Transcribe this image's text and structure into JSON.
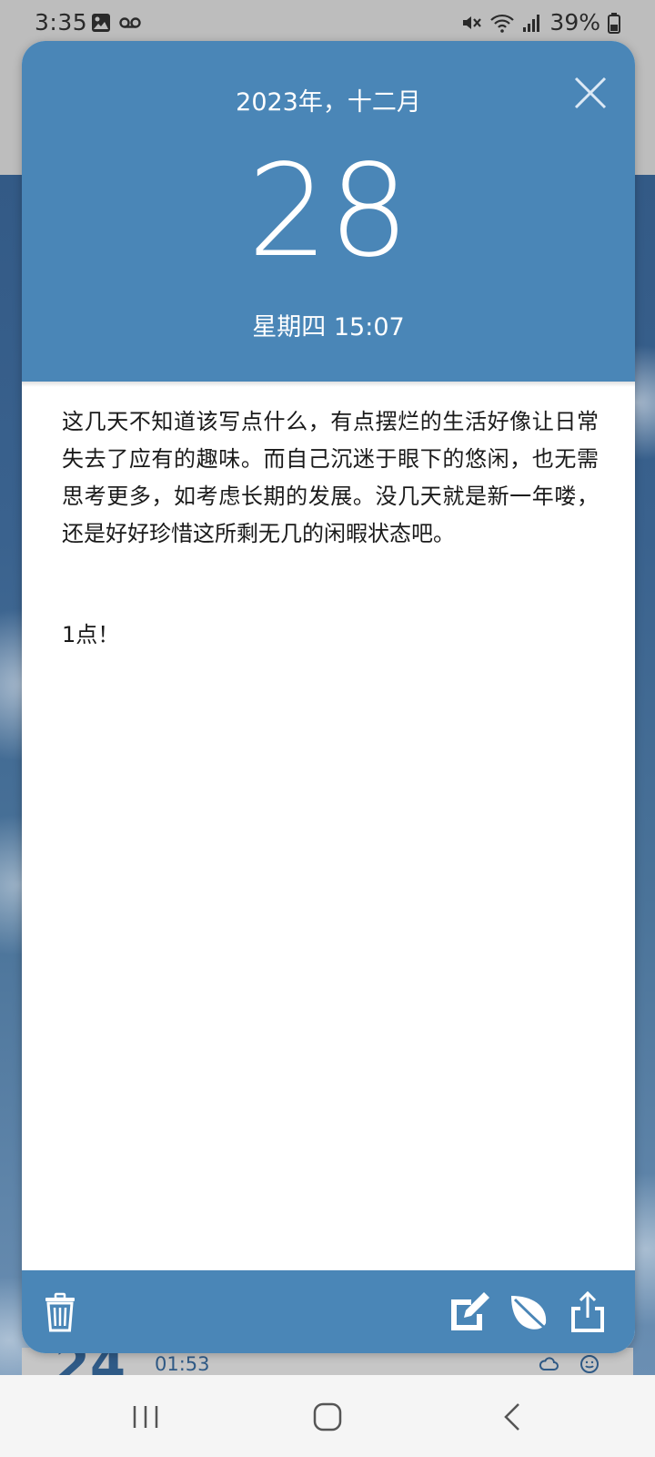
{
  "status_bar": {
    "time": "3:35",
    "battery": "39%",
    "left_icons": [
      "gallery-icon",
      "voicemail-icon"
    ],
    "right_icons": [
      "mute-icon",
      "wifi-icon",
      "signal-icon",
      "battery-icon"
    ]
  },
  "background": {
    "peek_number": "24",
    "peek_time": "01:53"
  },
  "entry": {
    "year_month": "2023年，十二月",
    "day": "28",
    "weekday_time": "星期四 15:07",
    "body": "这几天不知道该写点什么，有点摆烂的生活好像让日常失去了应有的趣味。而自己沉迷于眼下的悠闲，也无需思考更多，如考虑长期的发展。没几天就是新一年喽，还是好好珍惜这所剩无几的闲暇状态吧。",
    "note": "1点！"
  },
  "footer": {
    "actions": [
      "delete-icon",
      "edit-icon",
      "leaf-icon",
      "share-icon"
    ]
  },
  "colors": {
    "accent": "#4a86b7",
    "text": "#1a1a1a",
    "nav_bg": "#f5f5f5"
  }
}
